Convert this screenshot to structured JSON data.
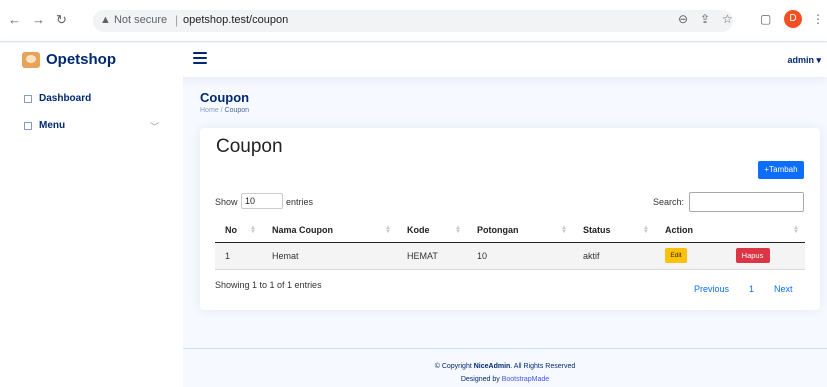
{
  "browser": {
    "security_label": "Not secure",
    "url": "opetshop.test/coupon",
    "profile_initial": "D"
  },
  "header": {
    "app_name": "Opetshop",
    "user": "admin"
  },
  "sidebar": {
    "items": [
      {
        "label": "Dashboard"
      },
      {
        "label": "Menu"
      }
    ]
  },
  "page": {
    "title": "Coupon",
    "breadcrumb_home": "Home",
    "breadcrumb_current": "Coupon"
  },
  "card": {
    "title": "Coupon",
    "add_button": "+Tambah",
    "show_label": "Show",
    "show_value": "10",
    "entries_label": "entries",
    "search_label": "Search:",
    "columns": [
      "No",
      "Nama Coupon",
      "Kode",
      "Potongan",
      "Status",
      "Action"
    ],
    "rows": [
      {
        "no": "1",
        "nama": "Hemat",
        "kode": "HEMAT",
        "potongan": "10",
        "status": "aktif",
        "edit": "Edit",
        "hapus": "Hapus"
      }
    ],
    "info": "Showing 1 to 1 of 1 entries",
    "pager": {
      "previous": "Previous",
      "page": "1",
      "next": "Next"
    }
  },
  "footer": {
    "copyright_prefix": "© Copyright",
    "brand": "NiceAdmin",
    "copyright_suffix": ". All Rights Reserved",
    "designed_prefix": "Designed by",
    "designer": "BootstrapMade"
  },
  "colors": {
    "primary": "#0d6efd",
    "brand": "#012970",
    "warning": "#ffc107",
    "danger": "#dc3545"
  }
}
